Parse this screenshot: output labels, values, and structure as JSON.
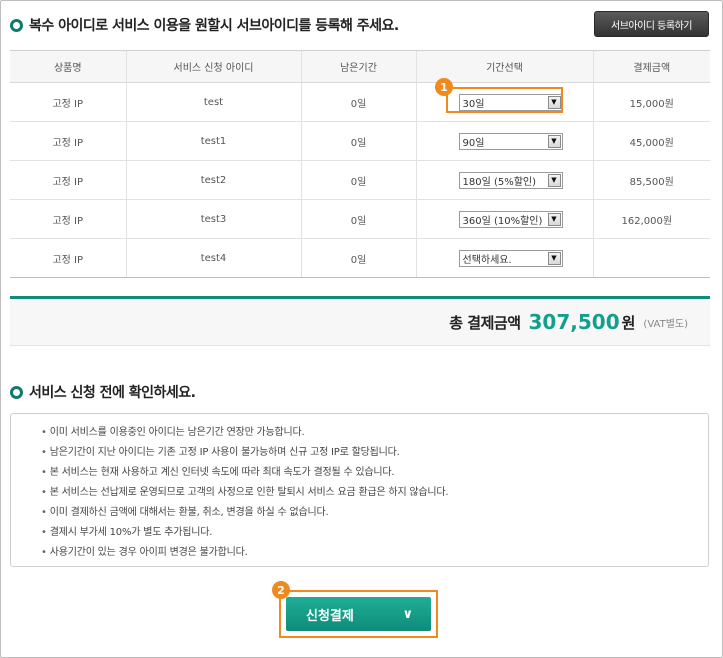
{
  "section1": {
    "title": "복수 아이디로 서비스 이용을 원할시 서브아이디를 등록해 주세요."
  },
  "sub_id_button": {
    "label": "서브아이디 등록하기"
  },
  "table": {
    "headers": [
      "상품명",
      "서비스 신청 아이디",
      "남은기간",
      "기간선택",
      "결제금액"
    ],
    "rows": [
      {
        "product": "고정 IP",
        "id": "test",
        "remaining": "0일",
        "period": "30일",
        "amount": "15,000원"
      },
      {
        "product": "고정 IP",
        "id": "test1",
        "remaining": "0일",
        "period": "90일",
        "amount": "45,000원"
      },
      {
        "product": "고정 IP",
        "id": "test2",
        "remaining": "0일",
        "period": "180일 (5%할인)",
        "amount": "85,500원"
      },
      {
        "product": "고정 IP",
        "id": "test3",
        "remaining": "0일",
        "period": "360일 (10%할인)",
        "amount": "162,000원"
      },
      {
        "product": "고정 IP",
        "id": "test4",
        "remaining": "0일",
        "period": "선택하세요.",
        "amount": ""
      }
    ]
  },
  "total": {
    "label": "총 결제금액",
    "amount": "307,500",
    "unit": "원",
    "vat_note": "(VAT별도)"
  },
  "section2": {
    "title": "서비스 신청 전에 확인하세요."
  },
  "notices": [
    "이미 서비스를 이용중인 아이디는 남은기간 연장만 가능합니다.",
    "남은기간이 지난 아이디는 기존 고정 IP 사용이 불가능하며 신규 고정 IP로 할당됩니다.",
    "본 서비스는 현재 사용하고 계신 인터넷 속도에 따라 최대 속도가 결정될 수 있습니다.",
    "본 서비스는 선납제로 운영되므로 고객의 사정으로 인한 탈퇴시 서비스 요금 환급은 하지 않습니다.",
    "이미 결제하신 금액에 대해서는 환불, 취소, 변경을 하실 수 없습니다.",
    "결제시 부가세 10%가 별도 추가됩니다.",
    "사용기간이 있는 경우 아이피 변경은 불가합니다."
  ],
  "apply_button": {
    "label": "신청결제"
  },
  "badges": [
    "1",
    "2"
  ],
  "colors": {
    "accent": "#11a08d",
    "highlight": "#f08a1e",
    "dark_button": "#333333"
  }
}
